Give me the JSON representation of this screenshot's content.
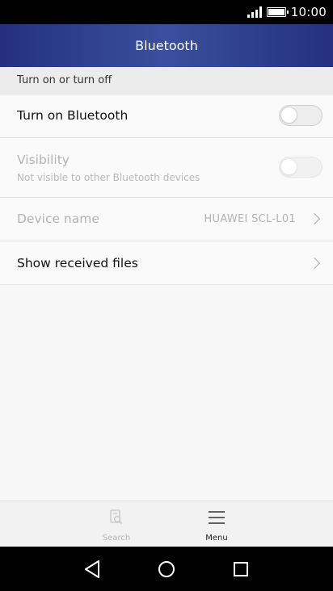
{
  "status_bar": {
    "time": "10:00",
    "signal_icon": "signal-icon",
    "battery_icon": "battery-icon"
  },
  "header": {
    "title": "Bluetooth"
  },
  "section": {
    "title": "Turn on or turn off"
  },
  "settings": {
    "bluetooth": {
      "label": "Turn on Bluetooth",
      "enabled": false
    },
    "visibility": {
      "label": "Visibility",
      "sublabel": "Not visible to other Bluetooth devices",
      "enabled": false
    },
    "device_name": {
      "label": "Device name",
      "value": "HUAWEI SCL-L01"
    },
    "received_files": {
      "label": "Show received files"
    }
  },
  "bottom_bar": {
    "search": {
      "label": "Search",
      "icon": "search-icon"
    },
    "menu": {
      "label": "Menu",
      "icon": "menu-icon"
    }
  },
  "nav_bar": {
    "back_icon": "back-icon",
    "home_icon": "home-icon",
    "recents_icon": "recents-icon"
  },
  "colors": {
    "header_dark": "#24307f",
    "header_mid": "#3a4f9f",
    "background": "#f7f7f7"
  }
}
